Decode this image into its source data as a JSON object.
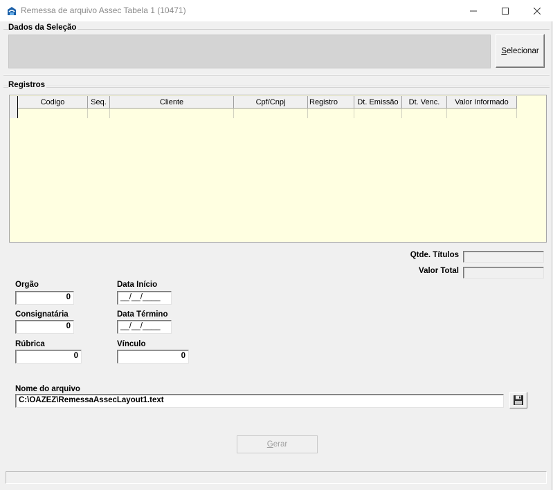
{
  "window": {
    "title": "Remessa de arquivo Assec Tabela 1 (10471)"
  },
  "selection": {
    "title": "Dados da Seleção",
    "select_button_first": "S",
    "select_button_rest": "elecionar"
  },
  "records": {
    "title": "Registros",
    "columns": [
      "Codigo",
      "Seq.",
      "Cliente",
      "Cpf/Cnpj",
      "Registro",
      "Dt. Emissão",
      "Dt. Venc.",
      "Valor Informado"
    ]
  },
  "summary": {
    "qtde_label": "Qtde. Títulos",
    "qtde_value": "",
    "valor_label": "Valor Total",
    "valor_value": ""
  },
  "form": {
    "orgao_label": "Orgão",
    "orgao_value": "0",
    "consignataria_label": "Consignatária",
    "consignataria_value": "0",
    "rubrica_label": "Rúbrica",
    "rubrica_value": "0",
    "data_inicio_label": "Data Início",
    "data_inicio_value": "__/__/____",
    "data_termino_label": "Data Término",
    "data_termino_value": "__/__/____",
    "vinculo_label": "Vínculo",
    "vinculo_value": "0"
  },
  "file": {
    "label": "Nome do arquivo",
    "value": "C:\\OAZEZ\\RemessaAssecLayout1.text"
  },
  "actions": {
    "gerar_first": "G",
    "gerar_rest": "erar"
  },
  "colors": {
    "grid_background": "#ffffe1",
    "window_background": "#f0f0f0",
    "disabled_text": "#a0a0a0"
  }
}
